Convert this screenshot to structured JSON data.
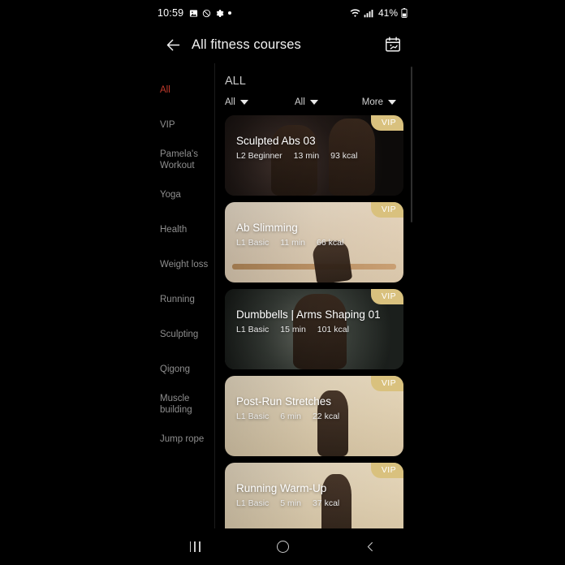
{
  "statusbar": {
    "time": "10:59",
    "icons_left": [
      "image-icon",
      "mute-icon",
      "gear-icon",
      "dot-icon"
    ],
    "wifi_icon": "wifi-icon",
    "signal_icon": "signal-icon",
    "battery_percent": "41%",
    "battery_icon": "battery-icon"
  },
  "appbar": {
    "back_icon": "back-arrow-icon",
    "title": "All fitness courses",
    "calendar_icon": "calendar-workout-icon"
  },
  "sidebar": {
    "active_index": 0,
    "items": [
      {
        "label": "All"
      },
      {
        "label": "VIP"
      },
      {
        "label": "Pamela's Workout"
      },
      {
        "label": "Yoga"
      },
      {
        "label": "Health"
      },
      {
        "label": "Weight loss"
      },
      {
        "label": "Running"
      },
      {
        "label": "Sculpting"
      },
      {
        "label": "Qigong"
      },
      {
        "label": "Muscle building"
      },
      {
        "label": "Jump rope"
      }
    ]
  },
  "main": {
    "heading": "ALL",
    "filters": [
      {
        "label": "All",
        "icon": "chevron-down-icon"
      },
      {
        "label": "All",
        "icon": "chevron-down-icon"
      },
      {
        "label": "More",
        "icon": "chevron-down-icon"
      }
    ],
    "courses": [
      {
        "title": "Sculpted Abs 03",
        "level": "L2 Beginner",
        "duration": "13 min",
        "calories": "93 kcal",
        "badge": "VIP"
      },
      {
        "title": "Ab Slimming",
        "level": "L1 Basic",
        "duration": "11 min",
        "calories": "66 kcal",
        "badge": "VIP"
      },
      {
        "title": "Dumbbells | Arms Shaping 01",
        "level": "L1 Basic",
        "duration": "15 min",
        "calories": "101 kcal",
        "badge": "VIP"
      },
      {
        "title": "Post-Run Stretches",
        "level": "L1 Basic",
        "duration": "6 min",
        "calories": "22 kcal",
        "badge": "VIP"
      },
      {
        "title": "Running Warm-Up",
        "level": "L1 Basic",
        "duration": "5 min",
        "calories": "37 kcal",
        "badge": "VIP"
      }
    ]
  },
  "navbar": {
    "recents_icon": "recents-icon",
    "home_icon": "home-icon",
    "back_icon": "back-icon"
  },
  "colors": {
    "accent": "#c0392b",
    "vip_badge": "#d9c17e",
    "background": "#000000",
    "text_primary": "#f2f2f2",
    "text_secondary": "#8e8e8e"
  }
}
